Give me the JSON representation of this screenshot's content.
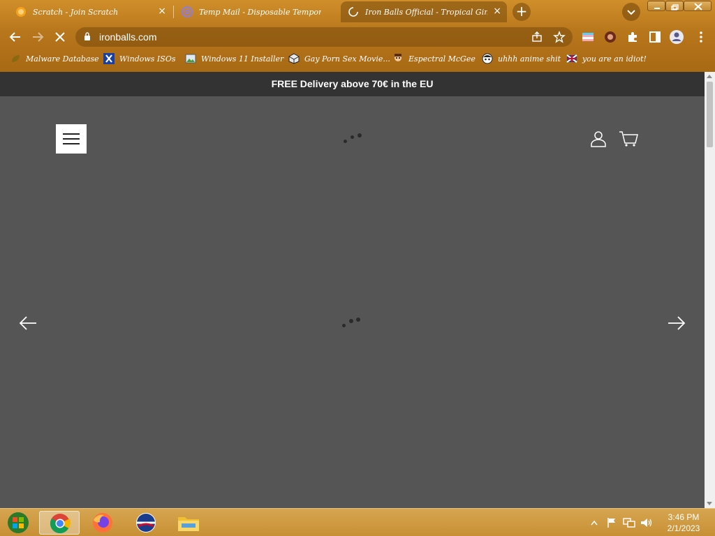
{
  "browser": {
    "tabs": [
      {
        "title": "Scratch - Join Scratch",
        "icon": "scratch-cat-icon",
        "active": false
      },
      {
        "title": "Temp Mail - Disposable Temporar",
        "icon": "at-sign-icon",
        "active": false
      },
      {
        "title": "Iron Balls Official - Tropical Gin",
        "icon": "loading-spinner-icon",
        "active": true
      }
    ],
    "close_glyph": "×",
    "new_tab_glyph": "+",
    "url": "ironballs.com",
    "bookmarks": [
      {
        "label": "Malware Database",
        "icon": "leaf-icon"
      },
      {
        "label": "Windows ISOs",
        "icon": "x-logo-icon"
      },
      {
        "label": "Windows 11 Installer",
        "icon": "image-icon"
      },
      {
        "label": "Gay Porn Sex Movie...",
        "icon": "cube-icon"
      },
      {
        "label": "Espectral McGee",
        "icon": "character-icon"
      },
      {
        "label": "uhhh anime shit",
        "icon": "anime-face-icon"
      },
      {
        "label": "you are an idiot!",
        "icon": "flag-icon"
      }
    ],
    "theme_color": "#b8761c"
  },
  "page": {
    "announcement": "FREE Delivery above 70€ in the EU",
    "background_color": "#555555",
    "announcement_bg": "#333333"
  },
  "taskbar": {
    "apps": [
      "start-orb-icon",
      "chrome-icon",
      "firefox-icon",
      "opera-icon",
      "file-explorer-icon"
    ],
    "time": "3:46 PM",
    "date": "2/1/2023"
  }
}
